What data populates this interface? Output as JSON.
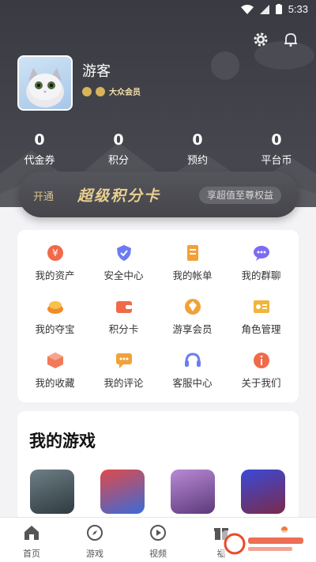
{
  "status_bar": {
    "time": "5:33"
  },
  "user": {
    "name": "游客",
    "member_label": "大众会员"
  },
  "stats": [
    {
      "value": "0",
      "label": "代金券"
    },
    {
      "value": "0",
      "label": "积分"
    },
    {
      "value": "0",
      "label": "预约"
    },
    {
      "value": "0",
      "label": "平台币"
    }
  ],
  "banner": {
    "open_label": "开通",
    "title": "超级积分卡",
    "pill": "享超值至尊权益"
  },
  "menu": [
    {
      "label": "我的资产",
      "icon": "yen-icon",
      "color": "#f06a4a"
    },
    {
      "label": "安全中心",
      "icon": "shield-icon",
      "color": "#6b7cf2"
    },
    {
      "label": "我的帐单",
      "icon": "bill-icon",
      "color": "#f2a13a"
    },
    {
      "label": "我的群聊",
      "icon": "chat-group-icon",
      "color": "#7b6cf0"
    },
    {
      "label": "我的夺宝",
      "icon": "treasure-icon",
      "color": "#f28a2a"
    },
    {
      "label": "积分卡",
      "icon": "wallet-icon",
      "color": "#f06a4a"
    },
    {
      "label": "游享会员",
      "icon": "vip-diamond-icon",
      "color": "#f2a13a"
    },
    {
      "label": "角色管理",
      "icon": "id-card-icon",
      "color": "#f2b43a"
    },
    {
      "label": "我的收藏",
      "icon": "box-icon",
      "color": "#f07a5a"
    },
    {
      "label": "我的评论",
      "icon": "comment-icon",
      "color": "#f2a13a"
    },
    {
      "label": "客服中心",
      "icon": "headset-icon",
      "color": "#6b7cf2"
    },
    {
      "label": "关于我们",
      "icon": "info-icon",
      "color": "#f06a4a"
    }
  ],
  "games": {
    "title": "我的游戏"
  },
  "tabs": [
    {
      "label": "首页",
      "icon": "home-icon"
    },
    {
      "label": "游戏",
      "icon": "compass-icon"
    },
    {
      "label": "视频",
      "icon": "play-icon"
    },
    {
      "label": "福",
      "icon": "gift-icon"
    },
    {
      "label": "",
      "icon": "user-icon"
    }
  ]
}
